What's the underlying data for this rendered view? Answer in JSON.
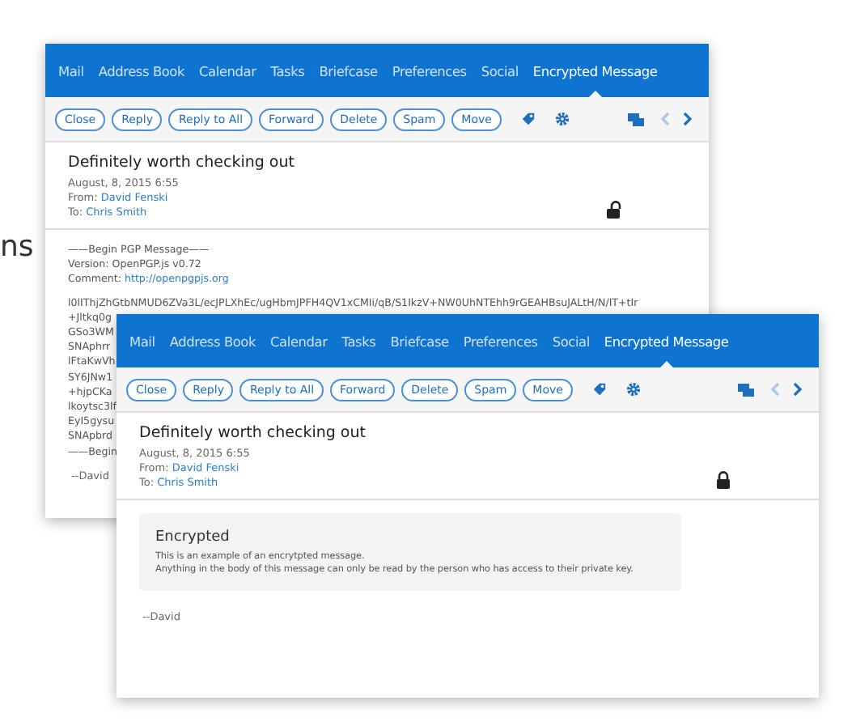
{
  "side_text": "ns",
  "windows": [
    {
      "nav": [
        {
          "label": "Mail",
          "selected": false
        },
        {
          "label": "Address Book",
          "selected": false
        },
        {
          "label": "Calendar",
          "selected": false
        },
        {
          "label": "Tasks",
          "selected": false
        },
        {
          "label": "Briefcase",
          "selected": false
        },
        {
          "label": "Preferences",
          "selected": false
        },
        {
          "label": "Social",
          "selected": false
        },
        {
          "label": "Encrypted Message",
          "selected": true
        }
      ],
      "buttons": [
        "Close",
        "Reply",
        "Reply to All",
        "Forward",
        "Delete",
        "Spam",
        "Move"
      ],
      "subject": "Definitely worth checking out",
      "date": "August, 8, 2015 6:55",
      "from_label": "From:",
      "from": "David Fenski",
      "to_label": "To:",
      "to": "Chris Smith",
      "locked": false,
      "body": {
        "kind": "pgp",
        "header": "——Begin PGP Message——",
        "version": "Version: OpenPGP.js v0.72",
        "comment_label": "Comment:",
        "comment_link": "http://openpgpjs.org",
        "lines": [
          "l0lIThjZhGtbNMUD6ZVa3L/ecJPLXhEc/ugHbmJPFH4QV1xCMIi/qB/S1IkzV+NW0UhNTEhh9rGEAHBsuJALtH/N/IT+tIr",
          "+Jltkq0g",
          "GSo3WM",
          "SNAphrr",
          "lFtaKwVh",
          "SY6JNw1",
          "+hjpCKa",
          "lkoytsc3lf",
          "EyI5gysu",
          "SNApbrd"
        ],
        "footer": "——Begin",
        "signature": "--David"
      }
    },
    {
      "nav": [
        {
          "label": "Mail",
          "selected": false
        },
        {
          "label": "Address Book",
          "selected": false
        },
        {
          "label": "Calendar",
          "selected": false
        },
        {
          "label": "Tasks",
          "selected": false
        },
        {
          "label": "Briefcase",
          "selected": false
        },
        {
          "label": "Preferences",
          "selected": false
        },
        {
          "label": "Social",
          "selected": false
        },
        {
          "label": "Encrypted Message",
          "selected": true
        }
      ],
      "buttons": [
        "Close",
        "Reply",
        "Reply to All",
        "Forward",
        "Delete",
        "Spam",
        "Move"
      ],
      "subject": "Definitely worth checking out",
      "date": "August, 8, 2015 6:55",
      "from_label": "From:",
      "from": "David Fenski",
      "to_label": "To:",
      "to": "Chris Smith",
      "locked": true,
      "body": {
        "kind": "notice",
        "title": "Encrypted",
        "lines": [
          "This is an example of an encrytpted message.",
          "Anything in the body of this message can only be read by the person who has access to their private key."
        ],
        "signature": "--David"
      }
    }
  ]
}
